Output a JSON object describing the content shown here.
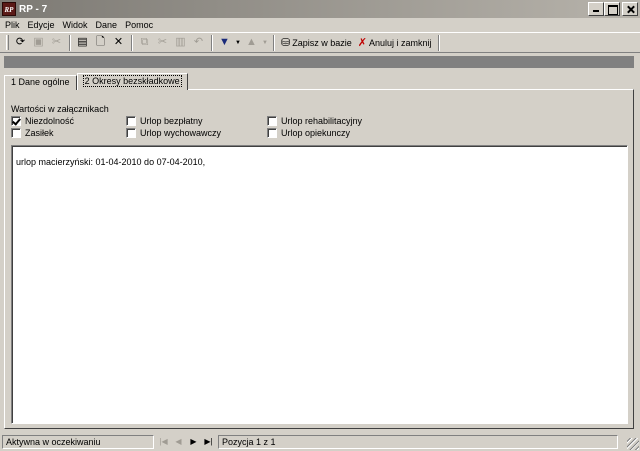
{
  "window": {
    "title": "RP - 7",
    "app_icon_text": "RP"
  },
  "menu": [
    {
      "label": "Plik"
    },
    {
      "label": "Edycje"
    },
    {
      "label": "Widok"
    },
    {
      "label": "Dane"
    },
    {
      "label": "Pomoc"
    }
  ],
  "toolbar": {
    "save_label": "Zapisz w bazie",
    "cancel_close_label": "Anuluj i zamknij"
  },
  "tabs": [
    {
      "label": "1 Dane ogólne",
      "active": false
    },
    {
      "label": "2 Okresy bezskładkowe",
      "active": true
    }
  ],
  "attachments": {
    "group_label": "Wartości w załącznikach",
    "checkboxes": [
      {
        "label": "Niezdolność",
        "checked": true
      },
      {
        "label": "Zasiłek",
        "checked": false
      },
      {
        "label": "Urlop bezpłatny",
        "checked": false
      },
      {
        "label": "Urlop wychowawczy",
        "checked": false
      },
      {
        "label": "Urlop rehabilitacyjny",
        "checked": false
      },
      {
        "label": "Urlop opiekunczy",
        "checked": false
      }
    ]
  },
  "content": {
    "text": "urlop macierzyński: 01-04-2010 do 07-04-2010,"
  },
  "status": {
    "state": "Aktywna w oczekiwaniu",
    "position": "Pozycja 1 z 1"
  }
}
